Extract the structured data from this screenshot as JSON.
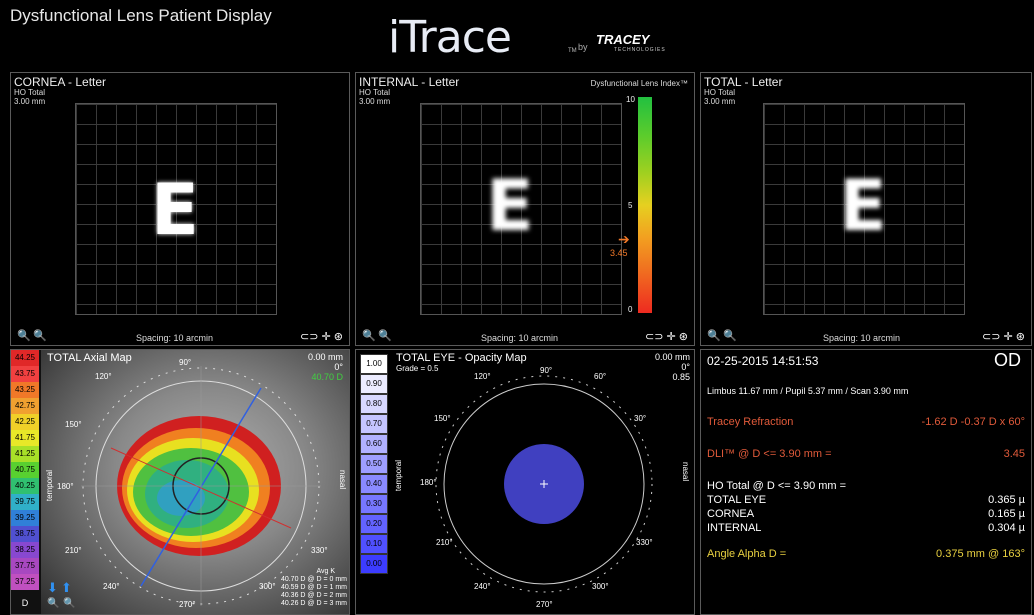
{
  "app_title": "Dysfunctional Lens Patient Display",
  "logo": {
    "name": "iTrace",
    "tm": "TM",
    "by": "by",
    "company": "TRACEY",
    "company_sub": "TECHNOLOGIES"
  },
  "panels": {
    "cornea": {
      "title": "CORNEA - Letter",
      "sub1": "HO Total",
      "sub2": "3.00 mm",
      "spacing": "Spacing: 10 arcmin",
      "letter": "E"
    },
    "internal": {
      "title": "INTERNAL - Letter",
      "sub1": "HO Total",
      "sub2": "3.00 mm",
      "spacing": "Spacing: 10 arcmin",
      "letter": "E",
      "dli_label": "Dysfunctional Lens Index™",
      "dli_max": "10",
      "dli_mid": "5",
      "dli_min": "0",
      "dli_value": "3.45",
      "dli_level": 0.345
    },
    "total": {
      "title": "TOTAL - Letter",
      "sub1": "HO Total",
      "sub2": "3.00 mm",
      "spacing": "Spacing: 10 arcmin",
      "letter": "E"
    },
    "axial": {
      "title": "TOTAL  Axial Map",
      "mm": "0.00 mm",
      "deg": "0°",
      "diopter": "40.70 D",
      "temporal": "temporal",
      "nasal": "nasal",
      "scale": [
        "44.25",
        "43.75",
        "43.25",
        "42.75",
        "42.25",
        "41.75",
        "41.25",
        "40.75",
        "40.25",
        "39.75",
        "39.25",
        "38.75",
        "38.25",
        "37.75",
        "37.25"
      ],
      "scale_colors": [
        "#e02828",
        "#f04040",
        "#f07828",
        "#f0a030",
        "#f0d028",
        "#e8e828",
        "#a8e028",
        "#58d030",
        "#30c070",
        "#30b0c8",
        "#3080d8",
        "#5050d0",
        "#8848d0",
        "#a848c0",
        "#c050c0"
      ],
      "unit": "D",
      "avgk_title": "Avg K",
      "avgk": [
        "40.70 D @ D = 0 mm",
        "40.59 D @ D = 1 mm",
        "40.36 D @ D = 2 mm",
        "40.26 D @ D = 3 mm"
      ],
      "angles": [
        "90°",
        "120°",
        "150°",
        "180°",
        "210°",
        "240°",
        "270°",
        "300°",
        "330°"
      ]
    },
    "opacity": {
      "title": "TOTAL EYE - Opacity Map",
      "grade": "Grade = 0.5",
      "mm": "0.00 mm",
      "deg": "0°",
      "val": "0.85",
      "temporal": "temporal",
      "nasal": "nasal",
      "scale": [
        "1.00",
        "0.90",
        "0.80",
        "0.70",
        "0.60",
        "0.50",
        "0.40",
        "0.30",
        "0.20",
        "0.10",
        "0.00"
      ],
      "angles": [
        "30°",
        "60°",
        "90°",
        "120°",
        "150°",
        "180°",
        "210°",
        "240°",
        "270°",
        "300°",
        "330°"
      ]
    },
    "info": {
      "datetime": "02-25-2015  14:51:53",
      "eye": "OD",
      "limbus": "Limbus 11.67 mm  /  Pupil 5.37 mm  /  Scan 3.90 mm",
      "refraction_label": "Tracey Refraction",
      "refraction_value": "-1.62 D -0.37 D x 60°",
      "dli_label": "DLI™ @ D <= 3.90 mm  =",
      "dli_value": "3.45",
      "ho_label": "HO Total @ D <= 3.90 mm  =",
      "rows": [
        {
          "label": "TOTAL EYE",
          "value": "0.365 µ"
        },
        {
          "label": "CORNEA",
          "value": "0.165 µ"
        },
        {
          "label": "INTERNAL",
          "value": "0.304 µ"
        }
      ],
      "alpha_label": "Angle Alpha D =",
      "alpha_value": "0.375 mm @ 163°"
    }
  },
  "colors": {
    "refraction": "#e05a3a",
    "dli": "#e05a3a",
    "alpha": "#e8d040",
    "dli_arrow": "#f07828"
  }
}
